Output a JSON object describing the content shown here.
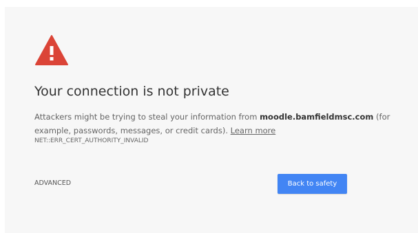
{
  "interstitial": {
    "icon": "warning-triangle-icon",
    "icon_color": "#db4437",
    "heading": "Your connection is not private",
    "description_prefix": "Attackers might be trying to steal your information from ",
    "host": "moodle.bamfieldmsc.com",
    "description_suffix": " (for example, passwords, messages, or credit cards). ",
    "learn_more": "Learn more",
    "error_code": "NET::ERR_CERT_AUTHORITY_INVALID",
    "advanced_label": "ADVANCED",
    "back_label": "Back to safety",
    "accent_color": "#4285f4",
    "background_color": "#f7f7f7"
  }
}
